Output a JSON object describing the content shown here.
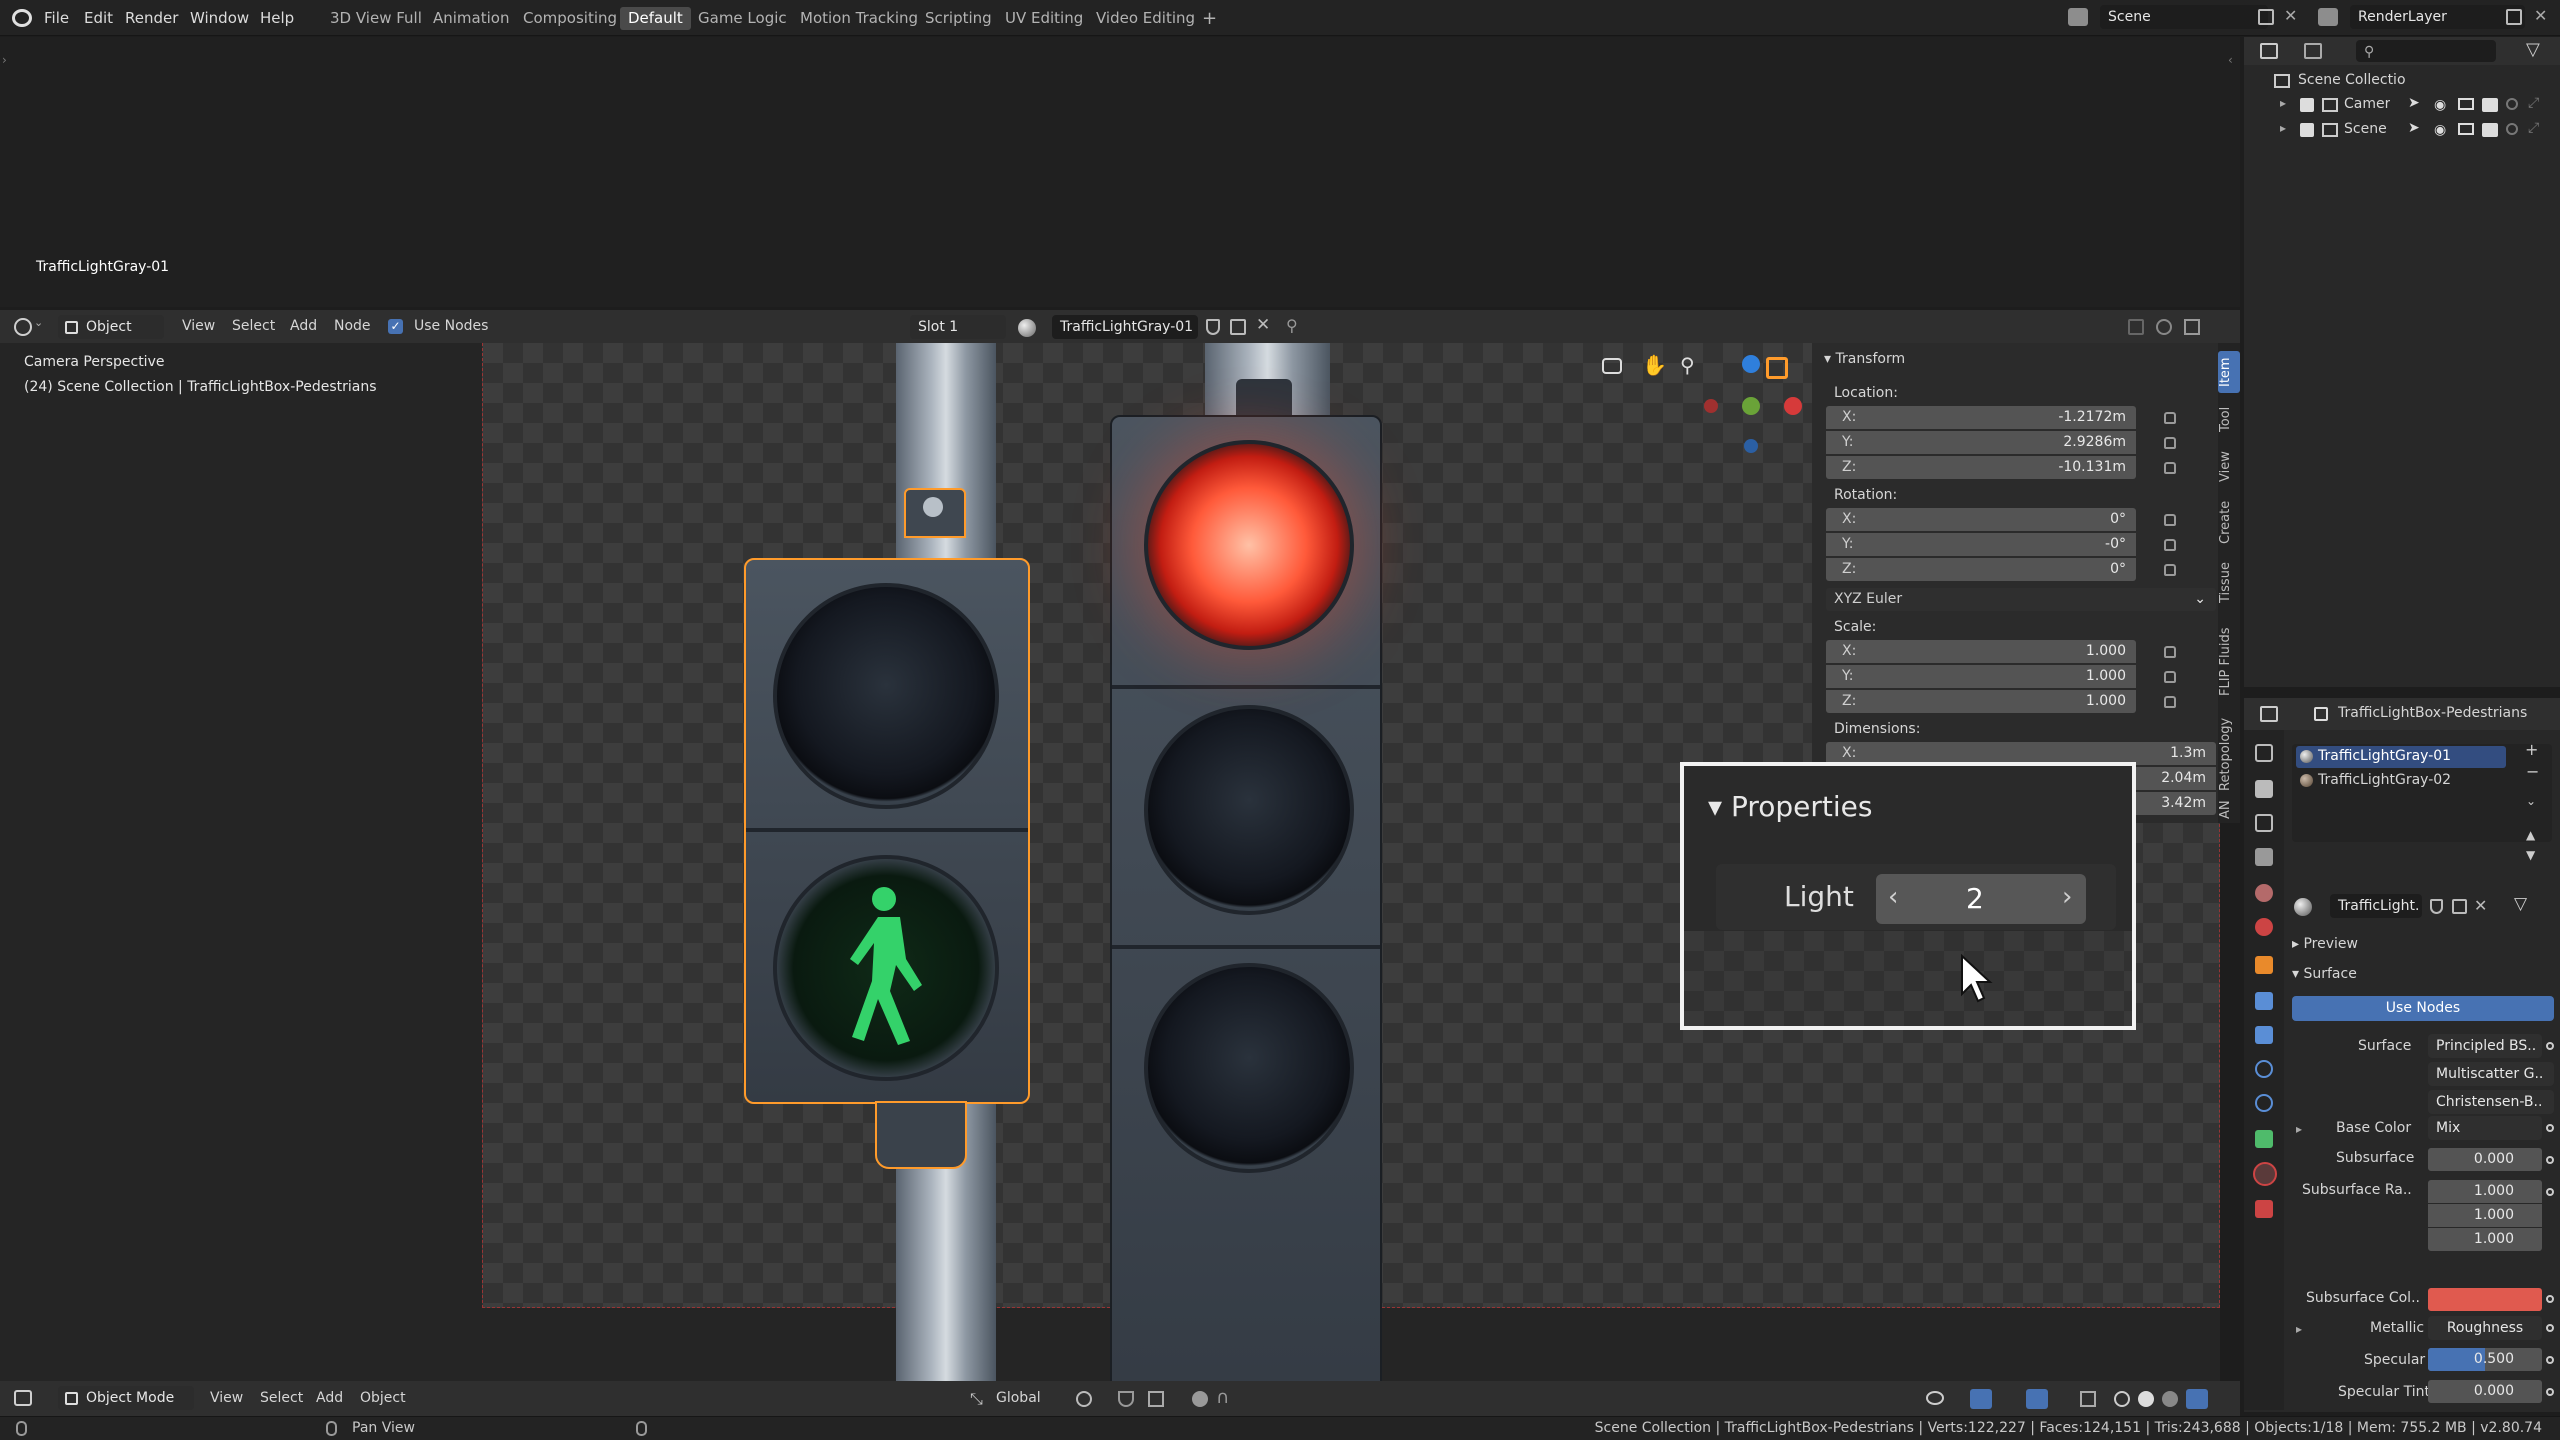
{
  "menu": [
    "File",
    "Edit",
    "Render",
    "Window",
    "Help"
  ],
  "workspaces": [
    "3D View Full",
    "Animation",
    "Compositing",
    "Default",
    "Game Logic",
    "Motion Tracking",
    "Scripting",
    "UV Editing",
    "Video Editing"
  ],
  "active_workspace": "Default",
  "scene_name": "Scene",
  "render_layer": "RenderLayer",
  "image_editor": {
    "label": "TrafficLightGray-01"
  },
  "node_header": {
    "mode": "Object",
    "menus": [
      "View",
      "Select",
      "Add",
      "Node"
    ],
    "use_nodes": "Use Nodes",
    "slot": "Slot 1",
    "material": "TrafficLightGray-01"
  },
  "viewport": {
    "camera_label": "Camera Perspective",
    "collection_label": "(24) Scene Collection | TrafficLightBox-Pedestrians"
  },
  "n_panel": {
    "section": "Transform",
    "location_label": "Location:",
    "location": [
      "-1.2172m",
      "2.9286m",
      "-10.131m"
    ],
    "rotation_label": "Rotation:",
    "rotation": [
      "0°",
      "-0°",
      "0°"
    ],
    "rotation_mode": "XYZ Euler",
    "scale_label": "Scale:",
    "scale": [
      "1.000",
      "1.000",
      "1.000"
    ],
    "dimensions_label": "Dimensions:",
    "dimensions": [
      "1.3m",
      "2.04m",
      "3.42m"
    ],
    "axis": [
      "X:",
      "Y:",
      "Z:"
    ],
    "tabs": [
      "Item",
      "Tool",
      "View",
      "Create",
      "Tissue",
      "FLIP Fluids",
      "Retopology",
      "AN"
    ]
  },
  "popup": {
    "title": "Properties",
    "light_label": "Light",
    "light_value": "2"
  },
  "outliner": {
    "root": "Scene Collectio",
    "items": [
      "Camera",
      "Scene"
    ]
  },
  "properties": {
    "object": "TrafficLightBox-Pedestrians",
    "materials": [
      "TrafficLightGray-01",
      "TrafficLightGray-02"
    ],
    "material_short": "TrafficLight.",
    "preview": "Preview",
    "surface_section": "Surface",
    "use_nodes": "Use Nodes",
    "surface_label": "Surface",
    "surface_value": "Principled BS..",
    "multiscatter": "Multiscatter G..",
    "christensen": "Christensen-B..",
    "base_color_label": "Base Color",
    "base_color_value": "Mix",
    "subsurface_label": "Subsurface",
    "subsurface_value": "0.000",
    "subsurface_radius_label": "Subsurface Ra..",
    "subsurface_radius": [
      "1.000",
      "1.000",
      "1.000"
    ],
    "subsurface_color_label": "Subsurface Col..",
    "subsurface_color": "#e05a4f",
    "metallic_label": "Metallic",
    "metallic_value": "Roughness",
    "specular_label": "Specular",
    "specular_value": "0.500",
    "specular_tint_label": "Specular Tint",
    "specular_tint_value": "0.000"
  },
  "bottom_header": {
    "mode": "Object Mode",
    "menus": [
      "View",
      "Select",
      "Add",
      "Object"
    ],
    "orientation": "Global"
  },
  "status": {
    "left": "Pan View",
    "right": "Scene Collection | TrafficLightBox-Pedestrians | Verts:122,227 | Faces:124,151 | Tris:243,688 | Objects:1/18 | Mem: 755.2 MB | v2.80.74"
  },
  "colors": {
    "accent_blue": "#4772b3",
    "select_orange": "#ff9b2b",
    "red_light": "#ff3b2f",
    "green_light": "#34d26a"
  }
}
